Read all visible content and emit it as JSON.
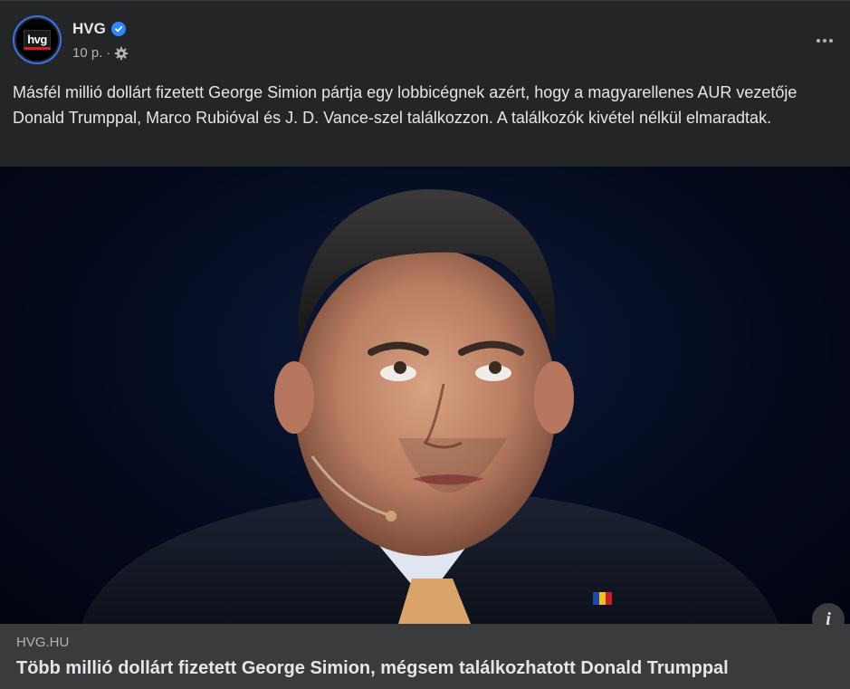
{
  "post": {
    "author": "HVG",
    "avatar_logo": "hvg",
    "timestamp": "10 p.",
    "separator": "·",
    "audience_icon": "gear-icon",
    "text": "Másfél millió dollárt fizetett George Simion pártja egy lobbicégnek azért, hogy a magyarellenes AUR vezetője Donald Trumppal, Marco Rubióval és J. D. Vance-szel találkozzon. A találkozók kivétel nélkül elmaradtak."
  },
  "link_preview": {
    "domain": "HVG.HU",
    "title": "Több millió dollárt fizetett George Simion, mégsem találkozhatott Donald Trumppal",
    "info_label": "i"
  },
  "colors": {
    "background": "#242526",
    "text_primary": "#e4e6eb",
    "text_secondary": "#b0b3b8",
    "verified": "#2d88ff",
    "link_bar": "#3a3b3c"
  }
}
